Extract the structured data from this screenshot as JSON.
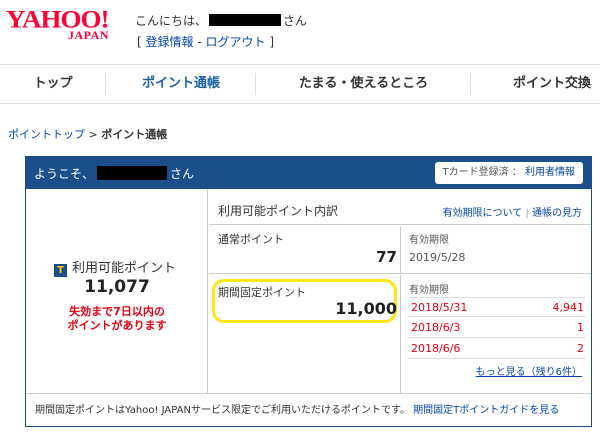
{
  "header": {
    "logo_main": "YAHOO!",
    "logo_sub": "JAPAN",
    "greeting_prefix": "こんにちは、",
    "greeting_suffix": "さん",
    "bracket_open": "[ ",
    "login_info": "登録情報",
    "link_sep": " - ",
    "logout": "ログアウト",
    "bracket_close": " ]"
  },
  "nav": {
    "items": [
      {
        "label": "トップ"
      },
      {
        "label": "ポイント通帳"
      },
      {
        "label": "たまる・使えるところ"
      },
      {
        "label": "ポイント交換"
      }
    ]
  },
  "breadcrumb": {
    "parent": "ポイントトップ",
    "sep": " > ",
    "current": "ポイント通帳"
  },
  "panel": {
    "welcome_prefix": "ようこそ、",
    "welcome_suffix": "さん",
    "tcard_status": "Tカード登録済 ：",
    "tcard_link": "利用者情報"
  },
  "summary": {
    "label": "利用可能ポイント",
    "icon": "T",
    "value": "11,077",
    "warning_line1": "失効まで7日以内の",
    "warning_line2": "ポイントがあります"
  },
  "breakdown": {
    "title": "利用可能ポイント内訳",
    "link_expiry": "有効期限について",
    "link_sep": " | ",
    "link_guide": "通帳の見方",
    "normal": {
      "label": "通常ポイント",
      "value": "77",
      "expiry_label": "有効期限",
      "expiry_date": "2019/5/28"
    },
    "fixed": {
      "label": "期間固定ポイント",
      "value": "11,000",
      "expiry_label": "有効期限",
      "rows": [
        {
          "date": "2018/5/31",
          "value": "4,941"
        },
        {
          "date": "2018/6/3",
          "value": "1"
        },
        {
          "date": "2018/6/6",
          "value": "2"
        }
      ],
      "more": "もっと見る（残り6件）"
    }
  },
  "footer": {
    "note": "期間固定ポイントはYahoo! JAPANサービス限定でご利用いただけるポイントです。",
    "link": "期間固定Tポイントガイドを見る"
  },
  "colors": {
    "brand_red": "#ff0033",
    "panel_blue": "#1b4f8c",
    "warning_red": "#e60012",
    "highlight_yellow": "#ffe617",
    "link_blue": "#0645ad"
  }
}
